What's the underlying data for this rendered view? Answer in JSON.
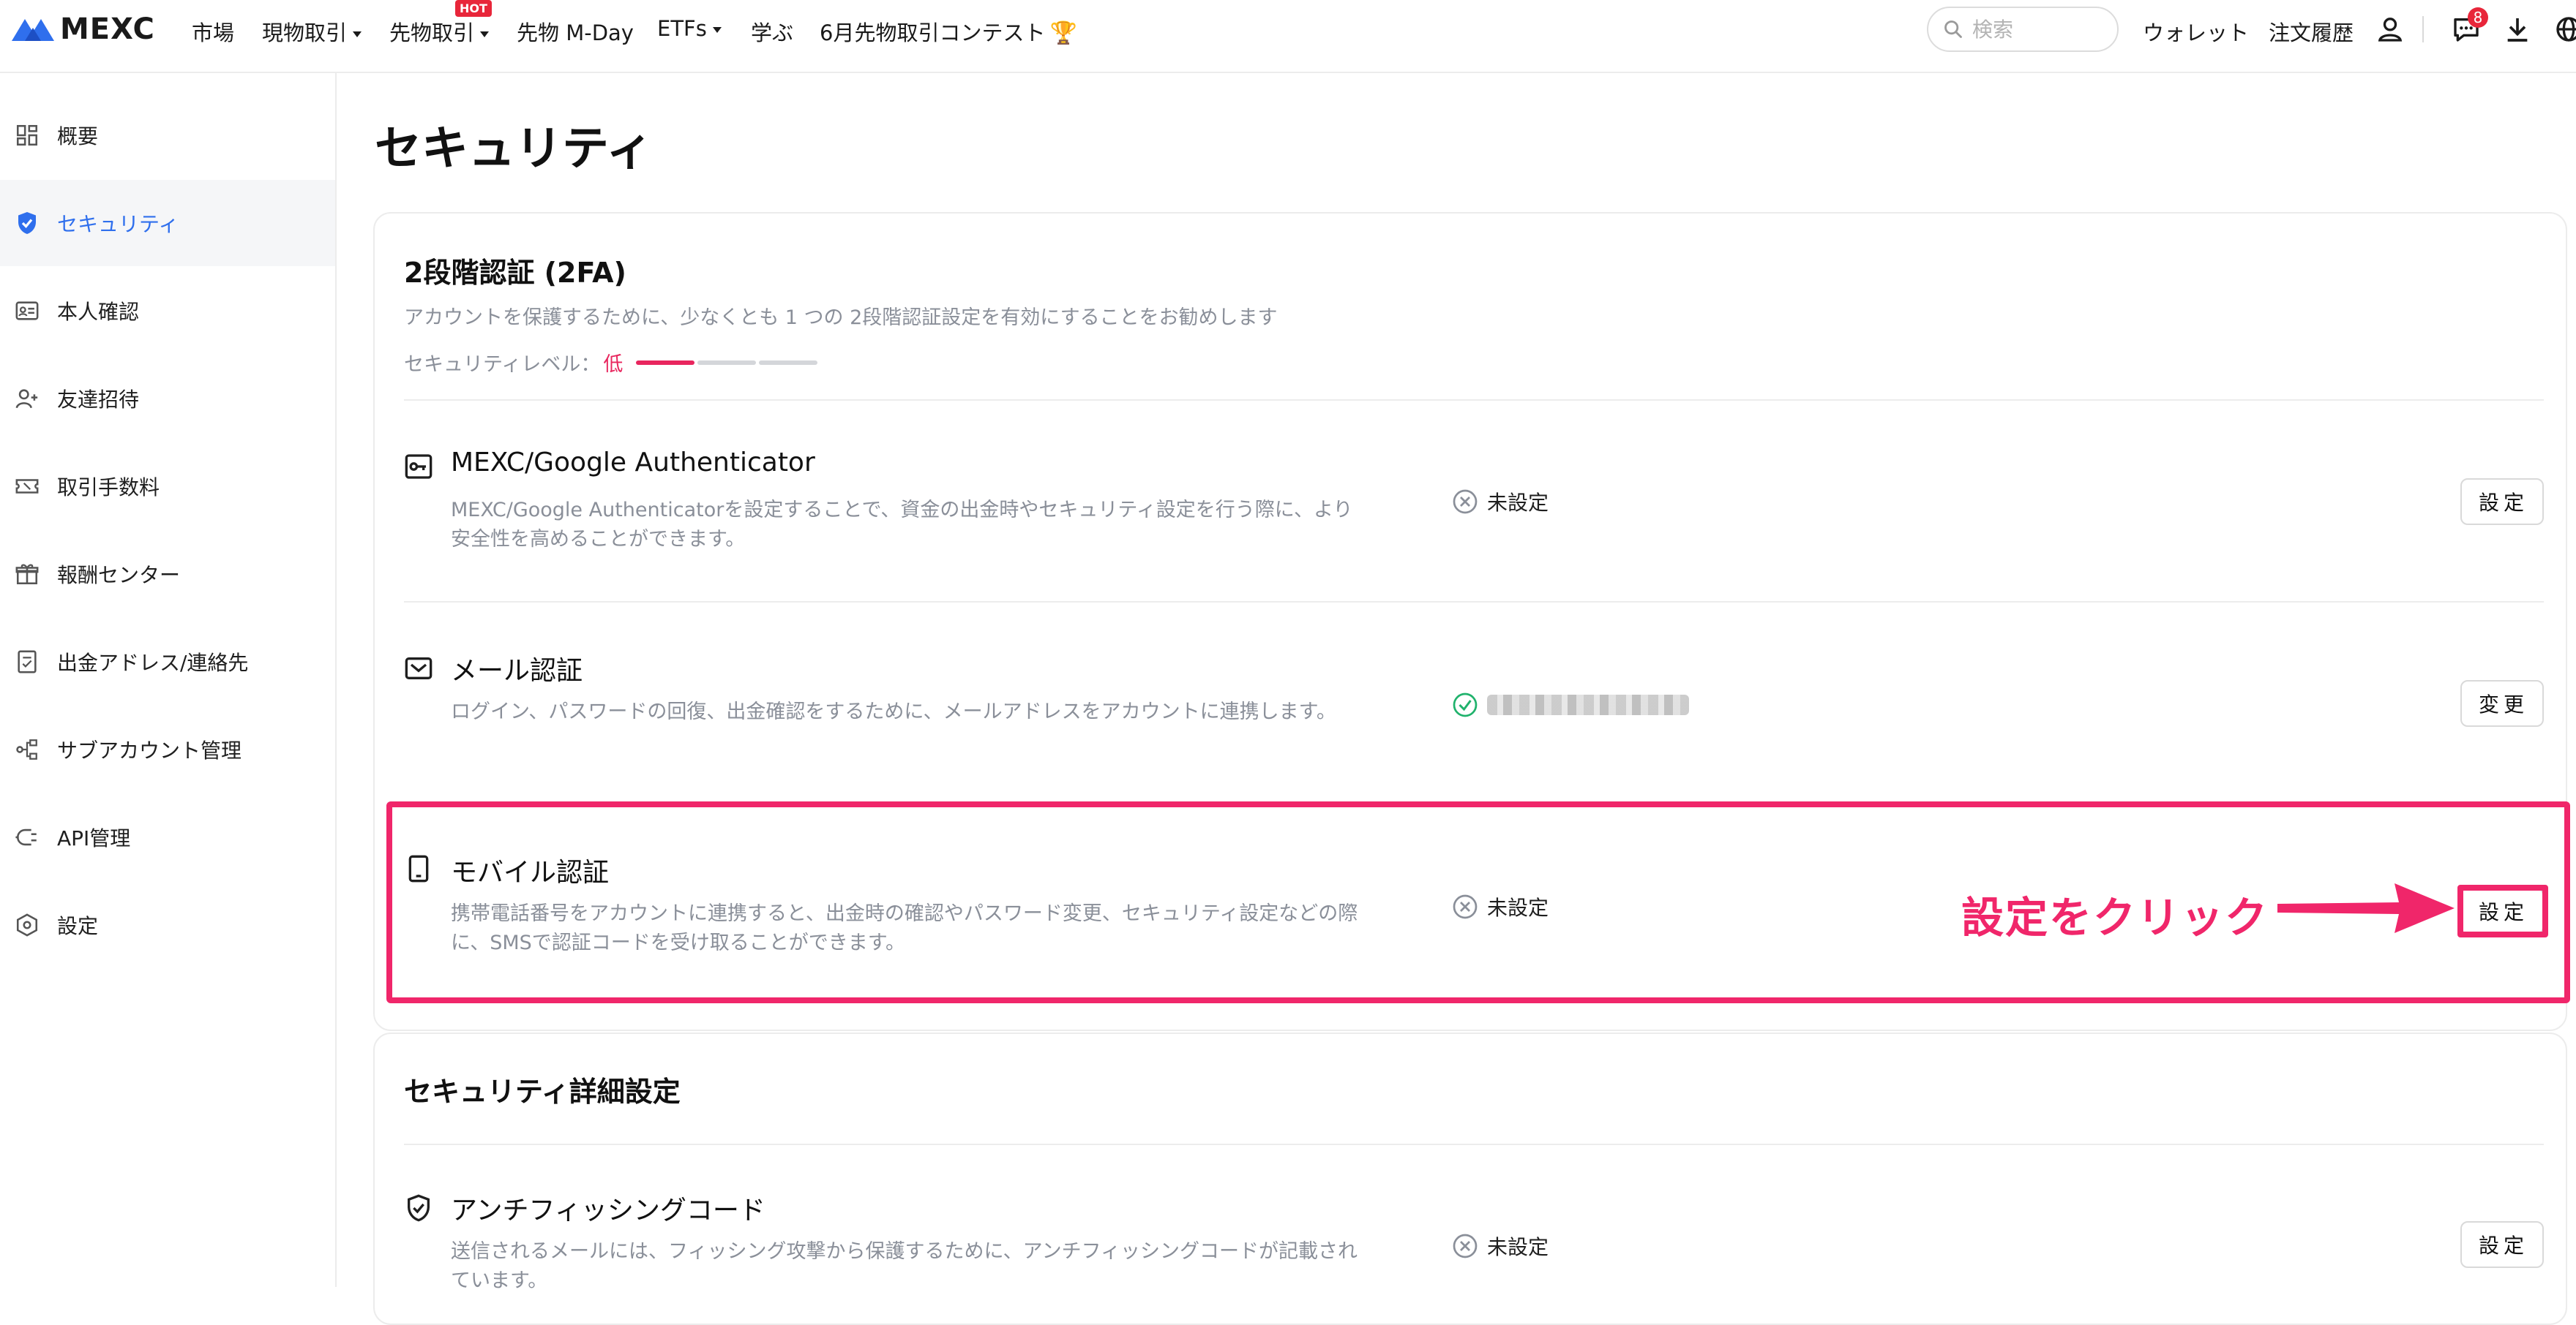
{
  "brand": {
    "name": "MEXC",
    "color": "#2f6fed"
  },
  "nav": {
    "items": [
      {
        "label": "市場",
        "has_caret": false
      },
      {
        "label": "現物取引",
        "has_caret": true
      },
      {
        "label": "先物取引",
        "has_caret": true,
        "badge": "HOT"
      },
      {
        "label": "先物 M-Day",
        "has_caret": false
      },
      {
        "label": "ETFs",
        "has_caret": true
      },
      {
        "label": "学ぶ",
        "has_caret": false
      },
      {
        "label": "6月先物取引コンテスト",
        "has_caret": false,
        "icon": "trophy-icon"
      }
    ],
    "search_placeholder": "検索",
    "wallet": "ウォレット",
    "order_history": "注文履歴",
    "notification_count": "8"
  },
  "sidebar": {
    "items": [
      {
        "label": "概要",
        "icon": "dashboard-icon"
      },
      {
        "label": "セキュリティ",
        "icon": "shield-icon",
        "active": true
      },
      {
        "label": "本人確認",
        "icon": "id-card-icon"
      },
      {
        "label": "友達招待",
        "icon": "user-add-icon"
      },
      {
        "label": "取引手数料",
        "icon": "ticket-icon"
      },
      {
        "label": "報酬センター",
        "icon": "gift-icon"
      },
      {
        "label": "出金アドレス/連絡先",
        "icon": "address-book-icon"
      },
      {
        "label": "サブアカウント管理",
        "icon": "sub-account-icon"
      },
      {
        "label": "API管理",
        "icon": "api-icon"
      },
      {
        "label": "設定",
        "icon": "settings-icon"
      }
    ]
  },
  "main": {
    "title": "セキュリティ",
    "twofa": {
      "title": "2段階認証 (2FA)",
      "description": "アカウントを保護するために、少なくとも 1 つの 2段階認証設定を有効にすることをお勧めします",
      "level_label": "セキュリティレベル：",
      "level_value": "低",
      "level_fraction": 0.33,
      "level_color": "#e8265e",
      "rows": [
        {
          "title": "MEXC/Google Authenticator",
          "icon": "key-icon",
          "desc": "MEXC/Google Authenticatorを設定することで、資金の出金時やセキュリティ設定を行う際に、より安全性を高めることができます。",
          "status": "未設定",
          "status_icon": "close-circle-icon",
          "button": "設定"
        },
        {
          "title": "メール認証",
          "icon": "mail-icon",
          "desc": "ログイン、パスワードの回復、出金確認をするために、メールアドレスをアカウントに連携します。",
          "status": "",
          "status_icon": "check-circle-icon",
          "button": "変更"
        },
        {
          "title": "モバイル認証",
          "icon": "mobile-icon",
          "desc": "携帯電話番号をアカウントに連携すると、出金時の確認やパスワード変更、セキュリティ設定などの際に、SMSで認証コードを受け取ることができます。",
          "status": "未設定",
          "status_icon": "close-circle-icon",
          "button": "設定"
        }
      ]
    },
    "advanced": {
      "title": "セキュリティ詳細設定",
      "rows": [
        {
          "title": "アンチフィッシングコード",
          "icon": "shield-check-icon",
          "desc": "送信されるメールには、フィッシング攻撃から保護するために、アンチフィッシングコードが記載されています。",
          "status": "未設定",
          "status_icon": "close-circle-icon",
          "button": "設定"
        }
      ]
    }
  },
  "annotation": {
    "text": "設定をクリック",
    "color": "#f0266a"
  }
}
